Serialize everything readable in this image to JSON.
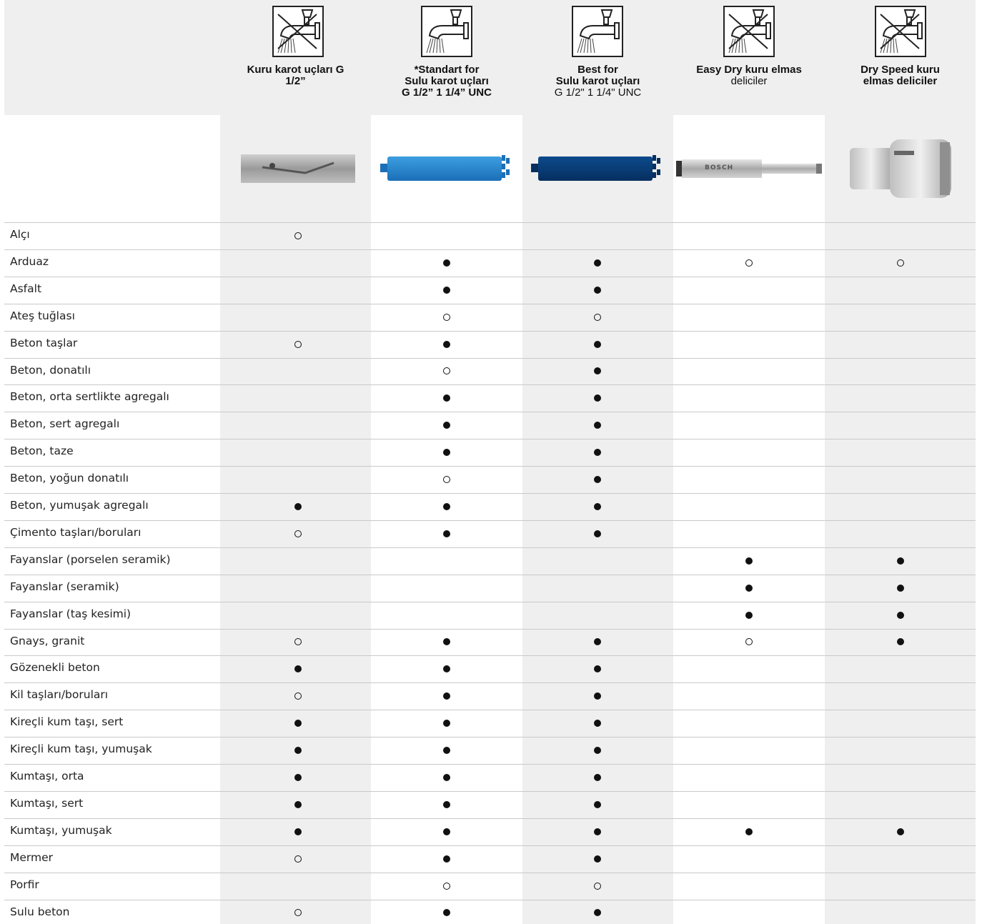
{
  "columns": [
    {
      "title_lines": [
        {
          "text": "Kuru karot uçları G",
          "bold": true
        },
        {
          "text": "1/2”",
          "bold": true
        }
      ],
      "icon": "dry-icon",
      "image": "dry-core-bit"
    },
    {
      "title_lines": [
        {
          "text": "*Standart for",
          "bold": true
        },
        {
          "text": "Sulu karot uçları",
          "bold": true
        },
        {
          "text": "G 1/2” 1 1/4” UNC",
          "bold": true
        }
      ],
      "icon": "wet-icon",
      "image": "standard-wet-core-bit"
    },
    {
      "title_lines": [
        {
          "text": "Best for",
          "bold": true
        },
        {
          "text": "Sulu karot uçları",
          "bold": true
        },
        {
          "text": "G 1/2\" 1 1/4\" UNC",
          "bold": false
        }
      ],
      "icon": "wet-icon",
      "image": "best-wet-core-bit"
    },
    {
      "title_lines": [
        {
          "text": "Easy Dry kuru elmas",
          "bold": true
        },
        {
          "text": "deliciler",
          "bold": false
        }
      ],
      "icon": "dry-icon",
      "image": "easy-dry-drill-bit"
    },
    {
      "title_lines": [
        {
          "text": "Dry Speed kuru",
          "bold": true
        },
        {
          "text": "elmas deliciler",
          "bold": true
        }
      ],
      "icon": "dry-icon",
      "image": "dry-speed-drill-bit"
    }
  ],
  "bit_logo_text": "BOSCH",
  "legend": {
    "full": "●",
    "open": "○",
    "empty": ""
  },
  "rows": [
    {
      "label": "Alçı",
      "marks": [
        "open",
        "",
        "",
        "",
        ""
      ]
    },
    {
      "label": "Arduaz",
      "marks": [
        "",
        "full",
        "full",
        "open",
        "open"
      ]
    },
    {
      "label": "Asfalt",
      "marks": [
        "",
        "full",
        "full",
        "",
        ""
      ]
    },
    {
      "label": "Ateş tuğlası",
      "marks": [
        "",
        "open",
        "open",
        "",
        ""
      ]
    },
    {
      "label": "Beton taşlar",
      "marks": [
        "open",
        "full",
        "full",
        "",
        ""
      ]
    },
    {
      "label": "Beton, donatılı",
      "marks": [
        "",
        "open",
        "full",
        "",
        ""
      ]
    },
    {
      "label": "Beton, orta sertlikte agregalı",
      "marks": [
        "",
        "full",
        "full",
        "",
        ""
      ]
    },
    {
      "label": "Beton, sert agregalı",
      "marks": [
        "",
        "full",
        "full",
        "",
        ""
      ]
    },
    {
      "label": "Beton, taze",
      "marks": [
        "",
        "full",
        "full",
        "",
        ""
      ]
    },
    {
      "label": "Beton, yoğun donatılı",
      "marks": [
        "",
        "open",
        "full",
        "",
        ""
      ]
    },
    {
      "label": "Beton, yumuşak agregalı",
      "marks": [
        "full",
        "full",
        "full",
        "",
        ""
      ]
    },
    {
      "label": "Çimento taşları/boruları",
      "marks": [
        "open",
        "full",
        "full",
        "",
        ""
      ]
    },
    {
      "label": "Fayanslar (porselen seramik)",
      "marks": [
        "",
        "",
        "",
        "full",
        "full"
      ]
    },
    {
      "label": "Fayanslar (seramik)",
      "marks": [
        "",
        "",
        "",
        "full",
        "full"
      ]
    },
    {
      "label": "Fayanslar (taş kesimi)",
      "marks": [
        "",
        "",
        "",
        "full",
        "full"
      ]
    },
    {
      "label": "Gnays, granit",
      "marks": [
        "open",
        "full",
        "full",
        "open",
        "full"
      ]
    },
    {
      "label": "Gözenekli beton",
      "marks": [
        "full",
        "full",
        "full",
        "",
        ""
      ]
    },
    {
      "label": "Kil taşları/boruları",
      "marks": [
        "open",
        "full",
        "full",
        "",
        ""
      ]
    },
    {
      "label": "Kireçli kum taşı, sert",
      "marks": [
        "full",
        "full",
        "full",
        "",
        ""
      ]
    },
    {
      "label": "Kireçli kum taşı, yumuşak",
      "marks": [
        "full",
        "full",
        "full",
        "",
        ""
      ]
    },
    {
      "label": "Kumtaşı, orta",
      "marks": [
        "full",
        "full",
        "full",
        "",
        ""
      ]
    },
    {
      "label": "Kumtaşı, sert",
      "marks": [
        "full",
        "full",
        "full",
        "",
        ""
      ]
    },
    {
      "label": "Kumtaşı, yumuşak",
      "marks": [
        "full",
        "full",
        "full",
        "full",
        "full"
      ]
    },
    {
      "label": "Mermer",
      "marks": [
        "open",
        "full",
        "full",
        "",
        ""
      ]
    },
    {
      "label": "Porfir",
      "marks": [
        "",
        "open",
        "open",
        "",
        ""
      ]
    },
    {
      "label": "Sulu beton",
      "marks": [
        "open",
        "full",
        "full",
        "",
        ""
      ]
    }
  ]
}
